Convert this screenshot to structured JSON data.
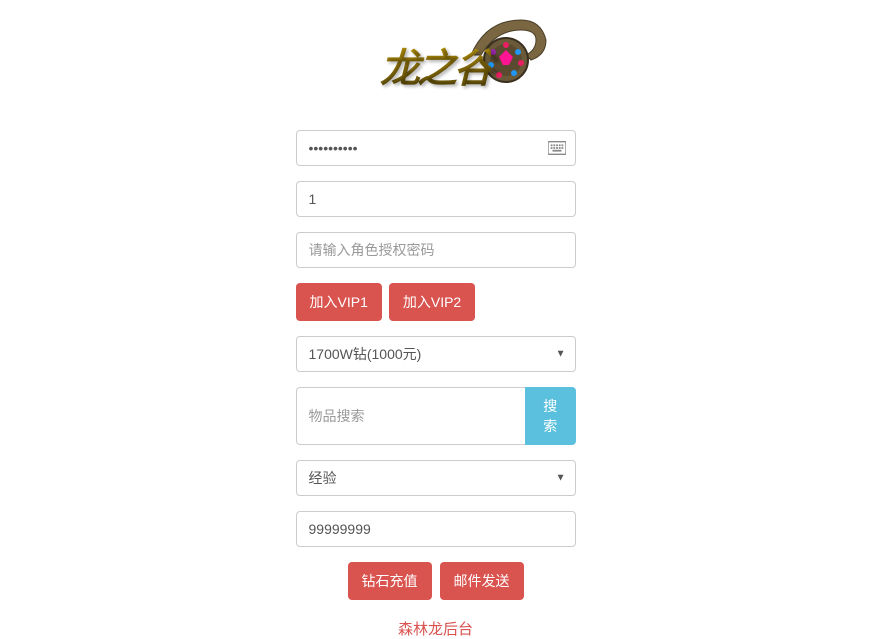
{
  "logo": {
    "text": "龙之谷"
  },
  "form": {
    "password_value": "••••••••••",
    "number_value": "1",
    "auth_placeholder": "请输入角色授权密码",
    "vip1_label": "加入VIP1",
    "vip2_label": "加入VIP2",
    "recharge_select": "1700W钻(1000元)",
    "item_search_placeholder": "物品搜索",
    "search_btn": "搜索",
    "exp_select": "经验",
    "quantity_value": "99999999",
    "diamond_recharge_btn": "钻石充值",
    "mail_send_btn": "邮件发送"
  },
  "footer": "森林龙后台"
}
